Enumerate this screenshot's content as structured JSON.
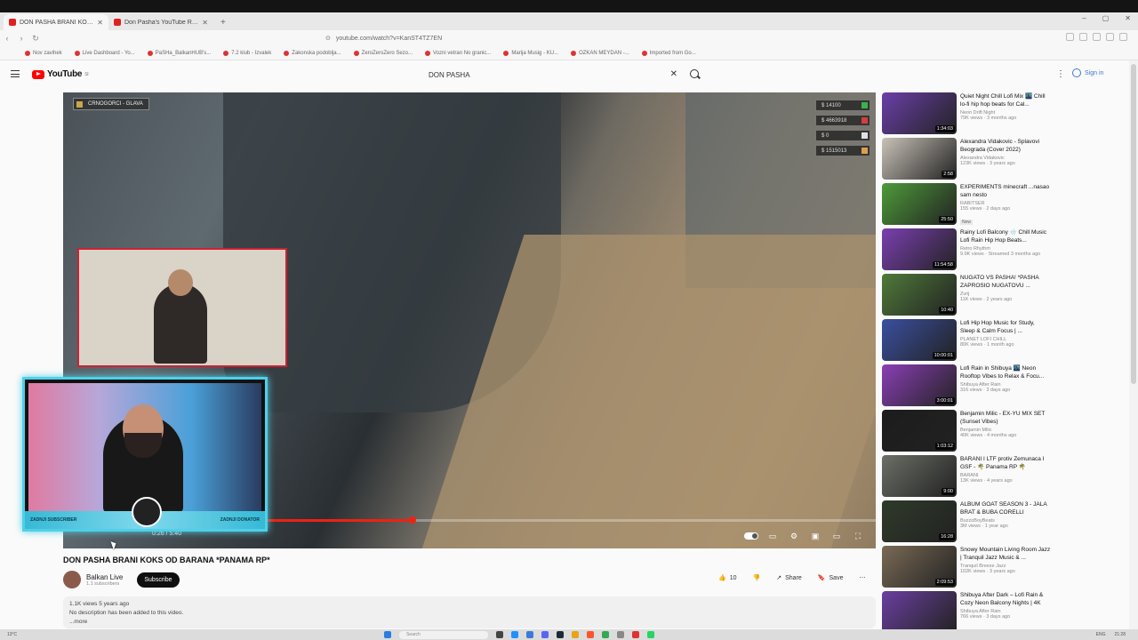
{
  "browser": {
    "tabs": [
      {
        "title": "DON PASHA BRANI KOKS OD",
        "active": true
      },
      {
        "title": "Don Pasha's YouTube Realtime Stats",
        "active": false
      }
    ],
    "url": "youtube.com/watch?v=KanST4TZ7EN",
    "bookmarks": [
      "Nov zavihek",
      "Live Dashboard - Yo...",
      "PaSHa_BalkanHUB's...",
      "7.2 klub - Izvalek",
      "Zakonska podoblja...",
      "ZeroZeroZero Sezo...",
      "Vozni vetran No granic...",
      "Marija Musig - KU...",
      "OZKAN MEYDAN -...",
      "Imported from Go..."
    ],
    "accent_color": "#ff0000"
  },
  "masthead": {
    "logo_text": "YouTube",
    "logo_region": "SI",
    "search_query": "DON PASHA",
    "signin_label": "Sign in"
  },
  "player": {
    "overlay_tag": "CRNOGORCI - GLAVA",
    "stats": [
      "$ 14100",
      "$ 4663918",
      "$ 0",
      "$ 1515013"
    ],
    "time": "0:26 / 5:40",
    "progress": 0.43,
    "buffered": 0.61
  },
  "webcam": {
    "banner_left": "ZADNJI SUBSCRIBER",
    "banner_right": "ZADNJI DONATOR"
  },
  "video": {
    "title": "DON PASHA BRANI KOKS OD BARANA *PANAMA RP*",
    "channel": "Balkan Live",
    "subscribers": "1.1 subscribers",
    "subscribe_label": "Subscribe",
    "likes": "10",
    "share_label": "Share",
    "save_label": "Save",
    "views_line": "1.1K views  5 years ago",
    "description": "No description has been added to this video.",
    "more_label": "...more"
  },
  "recommendations": [
    {
      "title": "Quiet Night Chill Lofi Mix 🌃 Chill lo-fi hip hop beats for Cal...",
      "channel": "Neon Drift Night",
      "meta": "79K views · 3 months ago",
      "duration": "1:34:03",
      "color": "#6a3fa8"
    },
    {
      "title": "Alexandra Vidakovic - Splavovi Beograda (Cover 2022)",
      "channel": "Alexandra Vidakovic",
      "meta": "123K views · 3 years ago",
      "duration": "2:58",
      "color": "#c9c2b8"
    },
    {
      "title": "EXPERIMENTS minecraft ...nasao sam nesto",
      "channel": "RABITSER",
      "meta": "155 views · 2 days ago",
      "badge": "New",
      "duration": "25:50",
      "color": "#4e9a3a"
    },
    {
      "title": "Rainy Lofi Balcony 🌧️ Chill Music Lofi Rain Hip Hop Beats...",
      "channel": "Retro Rhythm",
      "meta": "9.9K views · Streamed 3 months ago",
      "duration": "11:54:58",
      "color": "#7b3fb0"
    },
    {
      "title": "NUGATO VS PASHA! *PASHA ZAPROSIO NUGATOVU ...",
      "channel": "Zvrij",
      "meta": "11K views · 2 years ago",
      "duration": "10:40",
      "color": "#4f7a3a"
    },
    {
      "title": "Lofi Hip Hop Music for Study, Sleep & Calm Focus | ...",
      "channel": "PLANET LOFI CHILL",
      "meta": "80K views · 1 month ago",
      "duration": "10:00:01",
      "color": "#3a4fa0"
    },
    {
      "title": "Lofi Rain in Shibuya 🌃 Neon Rooftop Vibes to Relax & Focu...",
      "channel": "Shibuya After Rain",
      "meta": "316 views · 3 days ago",
      "duration": "3:00:01",
      "color": "#8a3fb5"
    },
    {
      "title": "Benjamin Milic - EX-YU MIX SET (Sunset Vibes)",
      "channel": "Benjamin Milic",
      "meta": "40K views · 4 months ago",
      "duration": "1:03:12",
      "color": "#1c1c1c"
    },
    {
      "title": "BARANI I LTF protiv Zemunaca I GSF - 🌴 Panama RP 🌴",
      "channel": "BARANI",
      "meta": "13K views · 4 years ago",
      "duration": "9:00",
      "color": "#6b6f66"
    },
    {
      "title": "ALBUM GOAT SEASON 3 - JALA BRAT & BUBA CORELLI",
      "channel": "BuzzoBoyBeats",
      "meta": "3M views · 1 year ago",
      "duration": "16:28",
      "color": "#2f3a2a"
    },
    {
      "title": "Snowy Mountain Living Room Jazz | Tranquil Jazz Music & ...",
      "channel": "Tranquil Breeze Jazz",
      "meta": "102K views · 3 years ago",
      "duration": "2:09:53",
      "color": "#7a6a55"
    },
    {
      "title": "Shibuya After Dark – Lofi Rain & Cozy Neon Balcony Nights | 4K",
      "channel": "Shibuya After Rain",
      "meta": "766 views · 3 days ago",
      "duration": "",
      "color": "#6b3fa0"
    }
  ],
  "taskbar": {
    "weather": "13°C",
    "search_placeholder": "Search",
    "lang": "ENG",
    "clock": "21:28"
  }
}
